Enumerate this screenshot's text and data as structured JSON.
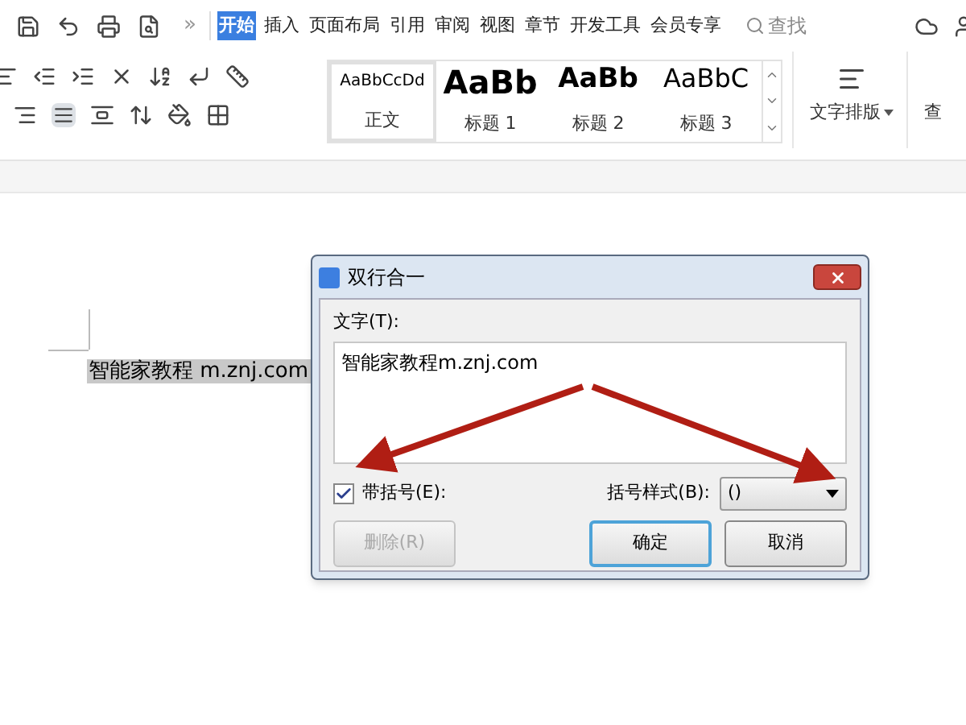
{
  "more": "»",
  "tabs": [
    {
      "label": "开始",
      "selected": true
    },
    {
      "label": "插入",
      "selected": false
    },
    {
      "label": "页面布局",
      "selected": false
    },
    {
      "label": "引用",
      "selected": false
    },
    {
      "label": "审阅",
      "selected": false
    },
    {
      "label": "视图",
      "selected": false
    },
    {
      "label": "章节",
      "selected": false
    },
    {
      "label": "开发工具",
      "selected": false
    },
    {
      "label": "会员专享",
      "selected": false
    }
  ],
  "search": "查找",
  "styles": [
    {
      "preview": "AaBbCcDd",
      "label": "正文",
      "kind": "body",
      "selected": true
    },
    {
      "preview": "AaBb",
      "label": "标题 1",
      "kind": "h1",
      "selected": false
    },
    {
      "preview": "AaBb",
      "label": "标题 2",
      "kind": "h2",
      "selected": false
    },
    {
      "preview": "AaBbC",
      "label": "标题 3",
      "kind": "h3",
      "selected": false
    }
  ],
  "text_layout": "文字排版",
  "find": "查",
  "document": {
    "text": "智能家教程 m.znj.com",
    "selected": true
  },
  "dialog": {
    "title": "双行合一",
    "text_label": "文字(T):",
    "text_value": "智能家教程m.znj.com",
    "checkbox": {
      "label": "带括号(E):",
      "checked": true
    },
    "bracket_label": "括号样式(B):",
    "bracket_value": "()",
    "buttons": [
      {
        "label": "删除(R)",
        "disabled": true,
        "default": false
      },
      {
        "label": "确定",
        "disabled": false,
        "default": true
      },
      {
        "label": "取消",
        "disabled": false,
        "default": false
      }
    ]
  }
}
